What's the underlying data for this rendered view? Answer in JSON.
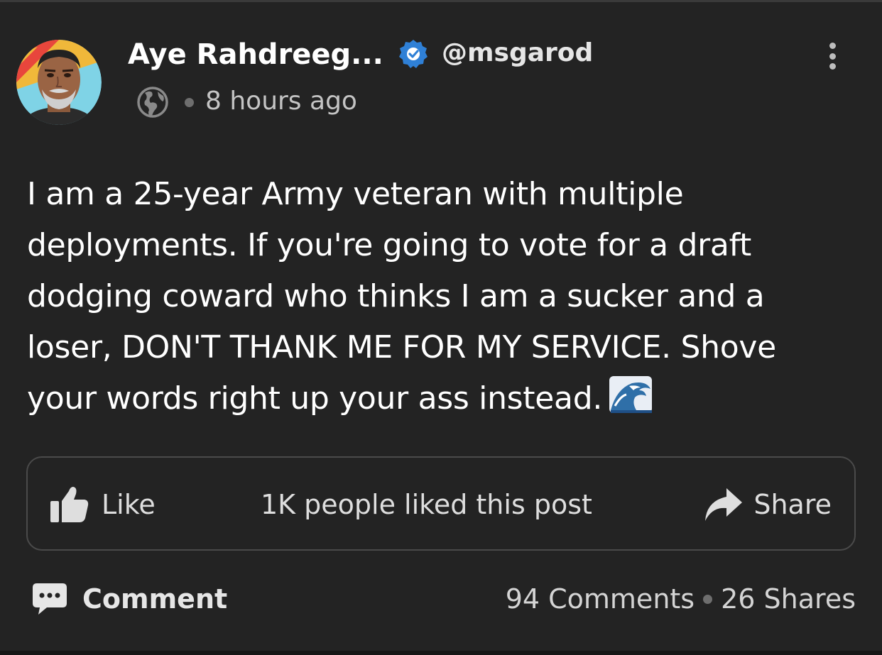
{
  "post": {
    "author": {
      "name": "Aye Rahdreeg...",
      "handle": "@msgarod",
      "verified": true,
      "avatar_icon": "avatar-portrait"
    },
    "visibility_icon": "globe-icon",
    "timestamp": "8 hours ago",
    "body_lines": [
      "I am a 25-year Army veteran with multiple",
      "deployments. If you're going to vote for a draft",
      "dodging coward who thinks I am a sucker and a",
      "loser, DON'T THANK ME FOR MY SERVICE.  Shove",
      "your words right up your ass instead."
    ],
    "body_emoji": "water-wave-emoji"
  },
  "actions": {
    "like_label": "Like",
    "likes_summary": "1K people liked this post",
    "share_label": "Share",
    "comment_label": "Comment"
  },
  "stats": {
    "comments": "94 Comments",
    "shares": "26 Shares"
  },
  "colors": {
    "background": "#232323",
    "verified_badge": "#2f80d6",
    "border": "#4a4a4a",
    "secondary_text": "#c4c4c4"
  }
}
